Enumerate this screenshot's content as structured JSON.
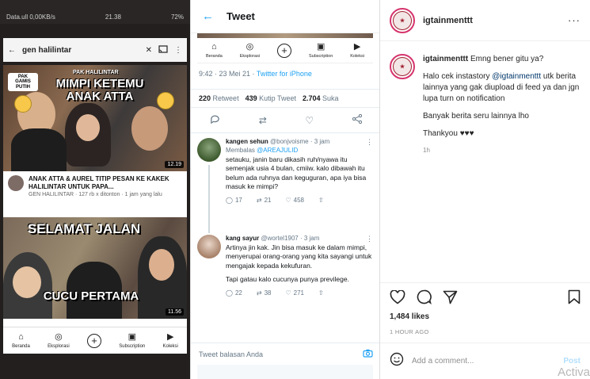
{
  "youtube": {
    "status_left": "Data.ull 0,00KB/s",
    "status_time": "21.38",
    "status_right": "72%",
    "search_query": "gen halilintar",
    "video1": {
      "badge": "PAK GAMIS PUTIH",
      "headline_small": "PAK HALILINTAR",
      "headline_big": "MIMPI KETEMU ANAK ATTA",
      "duration": "12.19",
      "title": "ANAK ATTA & AUREL TITIP PESAN KE KAKEK HALILINTAR UNTUK PAPA...",
      "meta": "GEN HALILINTAR · 127 rb x ditonton · 1 jam yang lalu"
    },
    "video2": {
      "headline_top": "SELAMAT JALAN",
      "headline_bottom": "CUCU PERTAMA",
      "duration": "11.56"
    },
    "nav": [
      {
        "label": "Beranda",
        "icon": "home-icon"
      },
      {
        "label": "Eksplorasi",
        "icon": "explore-icon"
      },
      {
        "label": "",
        "icon": "add-icon"
      },
      {
        "label": "Subscription",
        "icon": "subscription-icon"
      },
      {
        "label": "Koleksi",
        "icon": "library-icon"
      }
    ]
  },
  "twitter": {
    "title": "Tweet",
    "timestamp": "9:42 · 23 Mei 21 · ",
    "source": "Twitter for iPhone",
    "retweets_count": "220",
    "retweets_label": "Retweet",
    "quotes_count": "439",
    "quotes_label": "Kutip Tweet",
    "likes_count": "2.704",
    "likes_label": "Suka",
    "replies": [
      {
        "name": "kangen sehun",
        "handle": "@bonjvoisme · 3 jam",
        "reply_to_label": "Membalas ",
        "reply_to": "@AREAJULID",
        "text": "setauku, janin baru dikasih ruh/nyawa itu semenjak usia 4 bulan, cmiiw. kalo dibawah itu belum ada ruhnya dan keguguran, apa iya bisa masuk ke mimpi?",
        "replies": "17",
        "retweets": "21",
        "likes": "458"
      },
      {
        "name": "kang sayur",
        "handle": "@wortel1907 · 3 jam",
        "text": "Artinya jin kak. Jin bisa masuk ke dalam mimpi, menyerupai orang-orang yang kita sayangi untuk mengajak kepada kekufuran.",
        "text2": "Tapi gatau kalo cucunya punya previlege.",
        "replies": "22",
        "retweets": "38",
        "likes": "271"
      }
    ],
    "compose_placeholder": "Tweet balasan Anda"
  },
  "instagram": {
    "username": "igtainmenttt",
    "caption_user": "igtainmenttt",
    "caption_line1": " Emng bener gitu ya?",
    "caption_line2_pre": "Halo cek instastory ",
    "caption_mention": "@igtainmenttt",
    "caption_line2_post": " utk berita lainnya yang gak diupload di feed ya dan jgn lupa turn on notification",
    "caption_line3": "Banyak berita seru lainnya lho",
    "caption_line4": "Thankyou ♥♥♥",
    "caption_time": "1h",
    "likes": "1,484 likes",
    "posted_ago": "1 HOUR AGO",
    "comment_placeholder": "Add a comment...",
    "post_label": "Post",
    "watermark": "Activa"
  }
}
